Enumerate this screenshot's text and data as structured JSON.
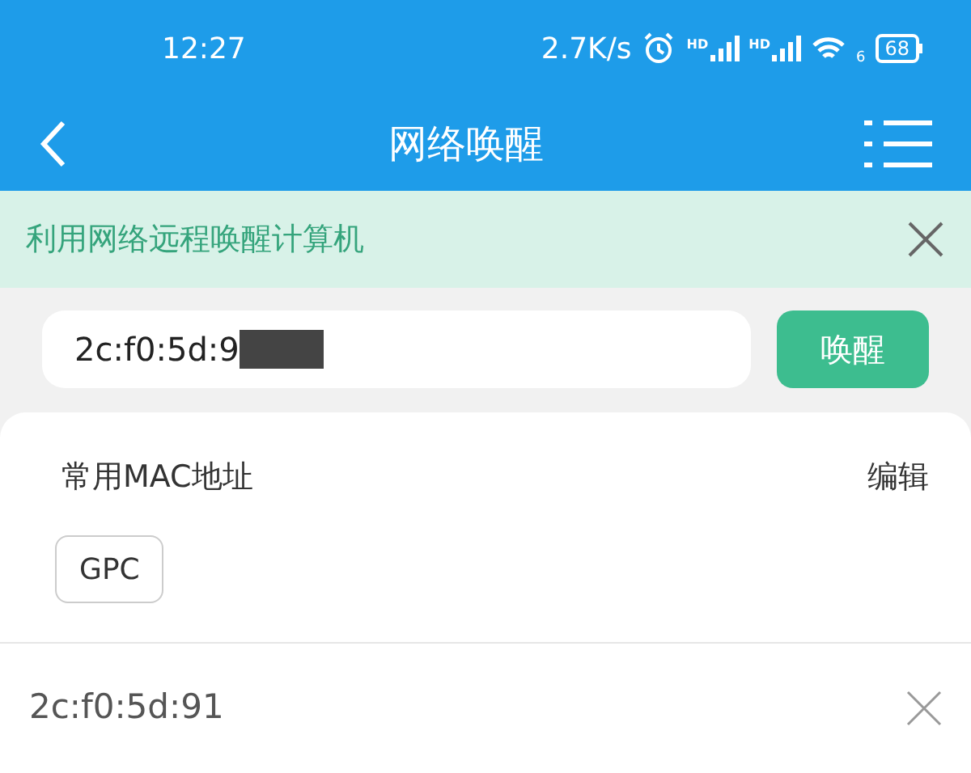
{
  "status_bar": {
    "time": "12:27",
    "speed": "2.7K/s",
    "signals": [
      {
        "label": "HD"
      },
      {
        "label": "HD"
      }
    ],
    "wifi_label": "6",
    "battery": "68"
  },
  "header": {
    "title": "网络唤醒"
  },
  "banner": {
    "text": "利用网络远程唤醒计算机"
  },
  "wake_form": {
    "value": "2c:f0:5d:9",
    "button": "唤醒"
  },
  "favorites": {
    "title": "常用MAC地址",
    "edit": "编辑",
    "items": [
      {
        "label": "GPC"
      }
    ]
  },
  "history": [
    {
      "mac": "2c:f0:5d:91"
    }
  ]
}
